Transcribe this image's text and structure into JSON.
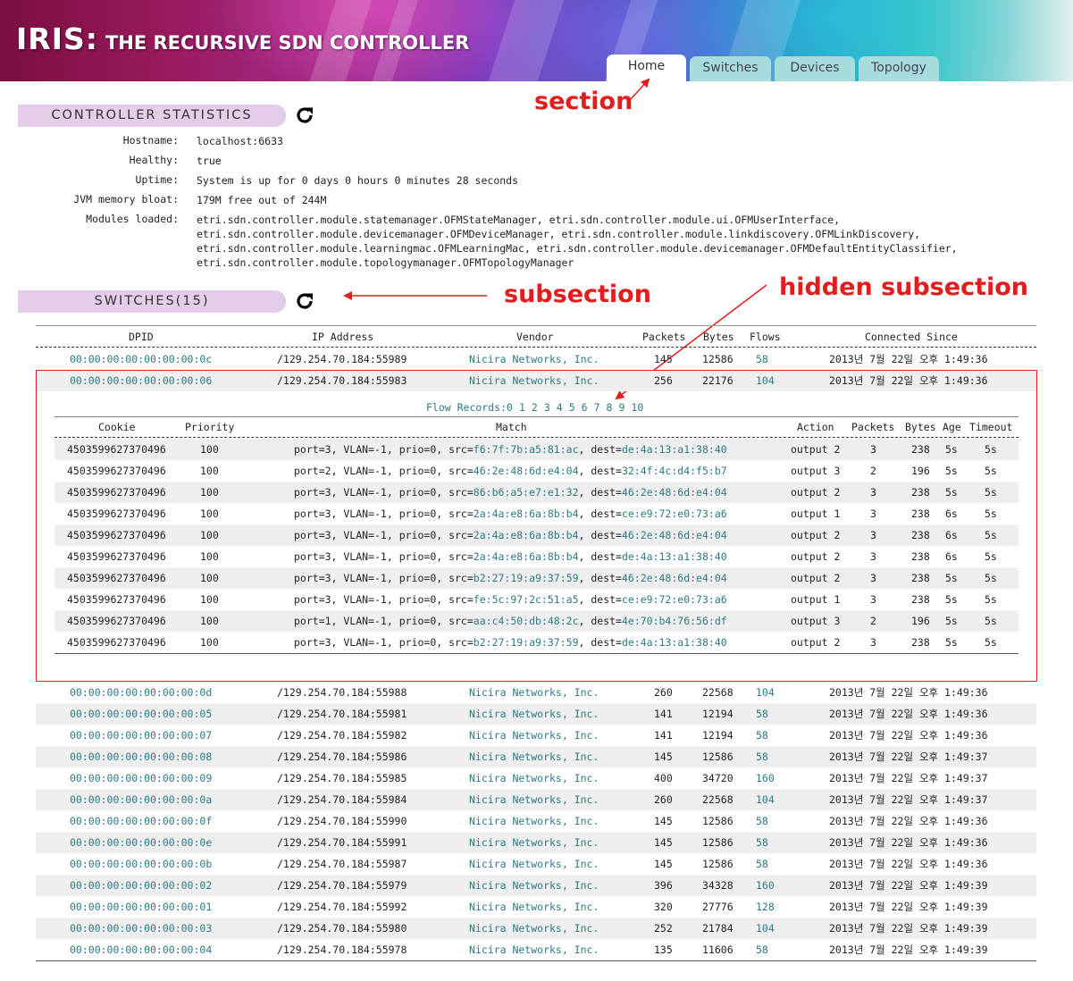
{
  "app": {
    "title_big": "IRIS:",
    "title_small": "THE RECURSIVE SDN CONTROLLER"
  },
  "tabs": [
    "Home",
    "Switches",
    "Devices",
    "Topology"
  ],
  "active_tab": "Home",
  "annotations": {
    "section": "section",
    "subsection": "subsection",
    "hidden_subsection": "hidden subsection",
    "color": "#e11d1d"
  },
  "controller_stats": {
    "heading": "CONTROLLER STATISTICS",
    "hostname_label": "Hostname:",
    "hostname": "localhost:6633",
    "healthy_label": "Healthy:",
    "healthy": "true",
    "uptime_label": "Uptime:",
    "uptime": "System is up for 0 days 0 hours 0 minutes 28 seconds",
    "jvm_label": "JVM memory bloat:",
    "jvm": "179M free out of 244M",
    "modules_label": "Modules loaded:",
    "modules_lines": [
      "etri.sdn.controller.module.statemanager.OFMStateManager, etri.sdn.controller.module.ui.OFMUserInterface,",
      "etri.sdn.controller.module.devicemanager.OFMDeviceManager, etri.sdn.controller.module.linkdiscovery.OFMLinkDiscovery,",
      "etri.sdn.controller.module.learningmac.OFMLearningMac, etri.sdn.controller.module.devicemanager.OFMDefaultEntityClassifier,",
      "etri.sdn.controller.module.topologymanager.OFMTopologyManager"
    ]
  },
  "switches": {
    "heading": "SWITCHES(15)",
    "columns": [
      "DPID",
      "IP Address",
      "Vendor",
      "Packets",
      "Bytes",
      "Flows",
      "Connected Since"
    ],
    "rows_top": [
      [
        "00:00:00:00:00:00:00:0c",
        "/129.254.70.184:55989",
        "Nicira Networks, Inc.",
        "145",
        "12586",
        "58",
        "2013년 7월 22일 오후 1:49:36"
      ],
      [
        "00:00:00:00:00:00:00:06",
        "/129.254.70.184:55983",
        "Nicira Networks, Inc.",
        "256",
        "22176",
        "104",
        "2013년 7월 22일 오후 1:49:36"
      ]
    ],
    "rows_bottom": [
      [
        "00:00:00:00:00:00:00:0d",
        "/129.254.70.184:55988",
        "Nicira Networks, Inc.",
        "260",
        "22568",
        "104",
        "2013년 7월 22일 오후 1:49:36"
      ],
      [
        "00:00:00:00:00:00:00:05",
        "/129.254.70.184:55981",
        "Nicira Networks, Inc.",
        "141",
        "12194",
        "58",
        "2013년 7월 22일 오후 1:49:36"
      ],
      [
        "00:00:00:00:00:00:00:07",
        "/129.254.70.184:55982",
        "Nicira Networks, Inc.",
        "141",
        "12194",
        "58",
        "2013년 7월 22일 오후 1:49:36"
      ],
      [
        "00:00:00:00:00:00:00:08",
        "/129.254.70.184:55986",
        "Nicira Networks, Inc.",
        "145",
        "12586",
        "58",
        "2013년 7월 22일 오후 1:49:37"
      ],
      [
        "00:00:00:00:00:00:00:09",
        "/129.254.70.184:55985",
        "Nicira Networks, Inc.",
        "400",
        "34720",
        "160",
        "2013년 7월 22일 오후 1:49:37"
      ],
      [
        "00:00:00:00:00:00:00:0a",
        "/129.254.70.184:55984",
        "Nicira Networks, Inc.",
        "260",
        "22568",
        "104",
        "2013년 7월 22일 오후 1:49:37"
      ],
      [
        "00:00:00:00:00:00:00:0f",
        "/129.254.70.184:55990",
        "Nicira Networks, Inc.",
        "145",
        "12586",
        "58",
        "2013년 7월 22일 오후 1:49:36"
      ],
      [
        "00:00:00:00:00:00:00:0e",
        "/129.254.70.184:55991",
        "Nicira Networks, Inc.",
        "145",
        "12586",
        "58",
        "2013년 7월 22일 오후 1:49:36"
      ],
      [
        "00:00:00:00:00:00:00:0b",
        "/129.254.70.184:55987",
        "Nicira Networks, Inc.",
        "145",
        "12586",
        "58",
        "2013년 7월 22일 오후 1:49:36"
      ],
      [
        "00:00:00:00:00:00:00:02",
        "/129.254.70.184:55979",
        "Nicira Networks, Inc.",
        "396",
        "34328",
        "160",
        "2013년 7월 22일 오후 1:49:39"
      ],
      [
        "00:00:00:00:00:00:00:01",
        "/129.254.70.184:55992",
        "Nicira Networks, Inc.",
        "320",
        "27776",
        "128",
        "2013년 7월 22일 오후 1:49:39"
      ],
      [
        "00:00:00:00:00:00:00:03",
        "/129.254.70.184:55980",
        "Nicira Networks, Inc.",
        "252",
        "21784",
        "104",
        "2013년 7월 22일 오후 1:49:39"
      ],
      [
        "00:00:00:00:00:00:00:04",
        "/129.254.70.184:55978",
        "Nicira Networks, Inc.",
        "135",
        "11606",
        "58",
        "2013년 7월 22일 오후 1:49:39"
      ]
    ]
  },
  "flows": {
    "label": "Flow Records:",
    "pages": [
      "0",
      "1",
      "2",
      "3",
      "4",
      "5",
      "6",
      "7",
      "8",
      "9",
      "10"
    ],
    "columns": [
      "Cookie",
      "Priority",
      "Match",
      "Action",
      "Packets",
      "Bytes",
      "Age",
      "Timeout"
    ],
    "rows": [
      [
        "4503599627370496",
        "100",
        "port=3, VLAN=-1, prio=0, src=",
        "f6:7f:7b:a5:81:ac",
        ", dest=",
        "de:4a:13:a1:38:40",
        "output 2",
        "3",
        "238",
        "5s",
        "5s"
      ],
      [
        "4503599627370496",
        "100",
        "port=2, VLAN=-1, prio=0, src=",
        "46:2e:48:6d:e4:04",
        ", dest=",
        "32:4f:4c:d4:f5:b7",
        "output 3",
        "2",
        "196",
        "5s",
        "5s"
      ],
      [
        "4503599627370496",
        "100",
        "port=3, VLAN=-1, prio=0, src=",
        "86:b6:a5:e7:e1:32",
        ", dest=",
        "46:2e:48:6d:e4:04",
        "output 2",
        "3",
        "238",
        "5s",
        "5s"
      ],
      [
        "4503599627370496",
        "100",
        "port=3, VLAN=-1, prio=0, src=",
        "2a:4a:e8:6a:8b:b4",
        ", dest=",
        "ce:e9:72:e0:73:a6",
        "output 1",
        "3",
        "238",
        "6s",
        "5s"
      ],
      [
        "4503599627370496",
        "100",
        "port=3, VLAN=-1, prio=0, src=",
        "2a:4a:e8:6a:8b:b4",
        ", dest=",
        "46:2e:48:6d:e4:04",
        "output 2",
        "3",
        "238",
        "6s",
        "5s"
      ],
      [
        "4503599627370496",
        "100",
        "port=3, VLAN=-1, prio=0, src=",
        "2a:4a:e8:6a:8b:b4",
        ", dest=",
        "de:4a:13:a1:38:40",
        "output 2",
        "3",
        "238",
        "6s",
        "5s"
      ],
      [
        "4503599627370496",
        "100",
        "port=3, VLAN=-1, prio=0, src=",
        "b2:27:19:a9:37:59",
        ", dest=",
        "46:2e:48:6d:e4:04",
        "output 2",
        "3",
        "238",
        "5s",
        "5s"
      ],
      [
        "4503599627370496",
        "100",
        "port=3, VLAN=-1, prio=0, src=",
        "fe:5c:97:2c:51:a5",
        ", dest=",
        "ce:e9:72:e0:73:a6",
        "output 1",
        "3",
        "238",
        "5s",
        "5s"
      ],
      [
        "4503599627370496",
        "100",
        "port=1, VLAN=-1, prio=0, src=",
        "aa:c4:50:db:48:2c",
        ", dest=",
        "4e:70:b4:76:56:df",
        "output 3",
        "2",
        "196",
        "5s",
        "5s"
      ],
      [
        "4503599627370496",
        "100",
        "port=3, VLAN=-1, prio=0, src=",
        "b2:27:19:a9:37:59",
        ", dest=",
        "de:4a:13:a1:38:40",
        "output 2",
        "3",
        "238",
        "5s",
        "5s"
      ]
    ]
  },
  "icons": {
    "refresh": "refresh-icon"
  },
  "colors": {
    "link": "#2b7a84",
    "section_bg": "#e3cde8",
    "tab_bg": "#a6dcdc"
  }
}
